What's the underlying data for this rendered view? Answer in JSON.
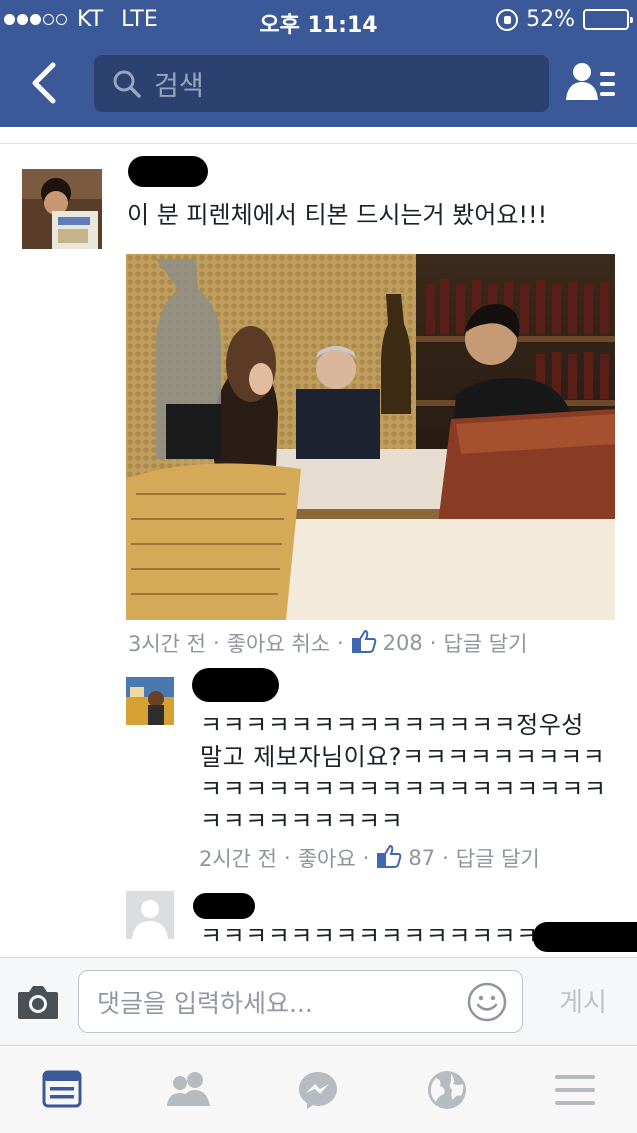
{
  "status_bar": {
    "carrier": "KT",
    "network": "LTE",
    "time": "오후 11:14",
    "battery_percent": "52%",
    "battery_level": 0.52,
    "signal_bars_on": 3,
    "signal_bars_total": 5
  },
  "header": {
    "search_placeholder": "검색",
    "back_icon": "chevron-left-icon",
    "friends_icon": "friend-list-icon",
    "background_color": "#3b5998"
  },
  "comments": [
    {
      "text": "이 분 피렌체에서 티본 드시는거 봤어요!!!",
      "time": "3시간 전",
      "like_action": "좋아요 취소",
      "like_count": "208",
      "reply_action": "답글 달기"
    },
    {
      "text": "ㅋㅋㅋㅋㅋㅋㅋㅋㅋㅋㅋㅋㅋㅋ정우성 말고 제보자님이요?ㅋㅋㅋㅋㅋㅋㅋㅋㅋㅋㅋㅋㅋㅋㅋㅋㅋㅋㅋㅋㅋㅋㅋㅋㅋㅋㅋㅋㅋㅋㅋㅋㅋㅋㅋㅋ",
      "time": "2시간 전",
      "like_action": "좋아요",
      "like_count": "87",
      "reply_action": "답글 달기"
    },
    {
      "text": "ㅋㅋㅋㅋㅋㅋㅋㅋㅋㅋㅋㅋㅋㅋㅋㅋㅋ"
    }
  ],
  "comment_bar": {
    "placeholder": "댓글을 입력하세요...",
    "post_label": "게시",
    "camera_icon": "camera-icon",
    "emoji_icon": "smiley-icon"
  },
  "tab_bar": {
    "tabs": [
      "news-feed-icon",
      "friends-icon",
      "messenger-icon",
      "globe-icon",
      "menu-icon"
    ],
    "active_color": "#3b5998",
    "inactive_color": "#b6bac1"
  },
  "colors": {
    "like_blue": "#4267b2",
    "meta_gray": "#90949c"
  }
}
